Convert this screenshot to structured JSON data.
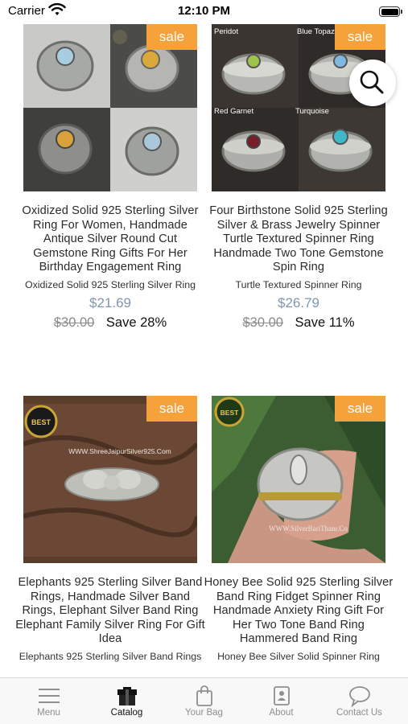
{
  "status_bar": {
    "carrier": "Carrier",
    "time": "12:10 PM"
  },
  "products": [
    {
      "badge": "sale",
      "title": "Oxidized Solid 925 Sterling Silver Ring For Women, Handmade Antique Silver Round Cut Gemstone Ring Gifts For Her Birthday Engagement Ring",
      "subtitle": "Oxidized Solid 925 Sterling Silver Ring",
      "price": "$21.69",
      "old_price": "$30.00",
      "save": "Save 28%"
    },
    {
      "badge": "sale",
      "image_labels": [
        "Peridot",
        "Blue Topaz",
        "Red Garnet",
        "Turquoise"
      ],
      "title": "Four Birthstone Solid 925 Sterling Silver & Brass Jewelry Spinner Turtle Textured Spinner Ring Handmade Two Tone Gemstone Spin Ring",
      "subtitle": "Turtle Textured Spinner Ring",
      "price": "$26.79",
      "old_price": "$30.00",
      "save": "Save 11%"
    },
    {
      "badge": "sale",
      "image_labels": [
        "BEST",
        "WWW.ShreeJaipurSilver925.Com"
      ],
      "title": "Elephants 925 Sterling Silver Band Rings, Handmade Silver Band Rings, Elephant Silver Band Ring Elephant Family Silver Ring For Gift Idea",
      "subtitle": "Elephants 925 Sterling Silver Band Rings"
    },
    {
      "badge": "sale",
      "image_labels": [
        "BEST",
        "WWW.SilverBariThanr.Co"
      ],
      "title": "Honey Bee Solid 925 Sterling Silver Band Ring Fidget Spinner Ring Handmade Anxiety Ring Gift For Her Two Tone Band Ring Hammered Band Ring",
      "subtitle": "Honey Bee Silver Solid Spinner Ring"
    }
  ],
  "tabs": [
    {
      "label": "Menu",
      "icon": "menu-icon"
    },
    {
      "label": "Catalog",
      "icon": "catalog-icon",
      "active": true
    },
    {
      "label": "Your Bag",
      "icon": "bag-icon"
    },
    {
      "label": "About",
      "icon": "about-icon"
    },
    {
      "label": "Contact Us",
      "icon": "chat-icon"
    }
  ],
  "colors": {
    "sale_badge": "#f5a23a",
    "price": "#8096ad",
    "tab_inactive": "#8e8e93"
  }
}
